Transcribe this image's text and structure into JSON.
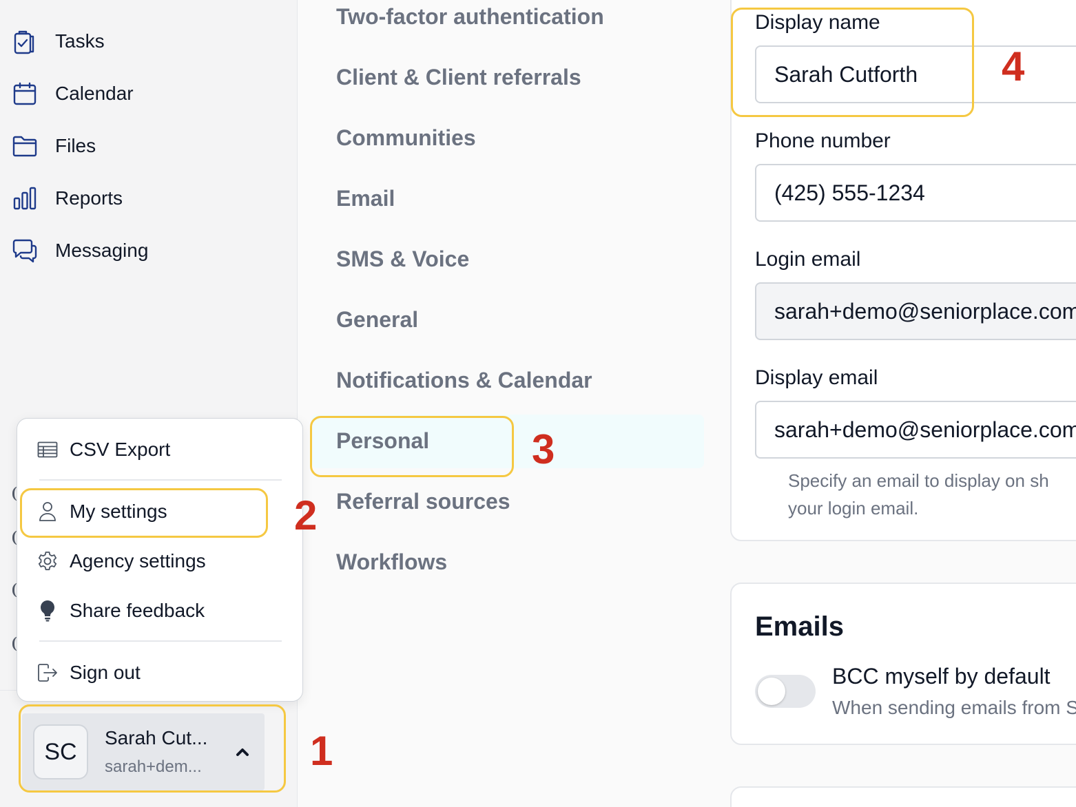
{
  "nav": {
    "items": [
      {
        "label": "Tasks",
        "icon": "clipboard-check-icon"
      },
      {
        "label": "Calendar",
        "icon": "calendar-icon"
      },
      {
        "label": "Files",
        "icon": "folder-icon"
      },
      {
        "label": "Reports",
        "icon": "bar-chart-icon"
      },
      {
        "label": "Messaging",
        "icon": "chat-bubbles-icon"
      }
    ]
  },
  "settings_nav": {
    "items": [
      "Two-factor authentication",
      "Client & Client referrals",
      "Communities",
      "Email",
      "SMS & Voice",
      "General",
      "Notifications & Calendar",
      "Personal",
      "Referral sources",
      "Workflows"
    ],
    "active": "Personal"
  },
  "personal_form": {
    "display_name": {
      "label": "Display name",
      "value": "Sarah Cutforth"
    },
    "phone_number": {
      "label": "Phone number",
      "value": "(425) 555-1234"
    },
    "login_email": {
      "label": "Login email",
      "value": "sarah+demo@seniorplace.com"
    },
    "display_email": {
      "label": "Display email",
      "value": "sarah+demo@seniorplace.com",
      "helper_line1": "Specify an email to display on sh",
      "helper_line2": "your login email."
    }
  },
  "emails_card": {
    "title": "Emails",
    "bcc_label": "BCC myself by default",
    "bcc_description": "When sending emails from S",
    "bcc_enabled": false
  },
  "user_menu": {
    "items": [
      {
        "label": "CSV Export",
        "icon": "table-icon"
      },
      {
        "label": "My settings",
        "icon": "user-icon"
      },
      {
        "label": "Agency settings",
        "icon": "gear-icon"
      },
      {
        "label": "Share feedback",
        "icon": "lightbulb-icon"
      },
      {
        "label": "Sign out",
        "icon": "sign-out-icon"
      }
    ]
  },
  "user": {
    "initials": "SC",
    "name": "Sarah Cut...",
    "email": "sarah+dem..."
  },
  "annotations": {
    "step1": "1",
    "step2": "2",
    "step3": "3",
    "step4": "4",
    "highlight_color": "#f5c842",
    "number_color": "#cf2e1f"
  }
}
